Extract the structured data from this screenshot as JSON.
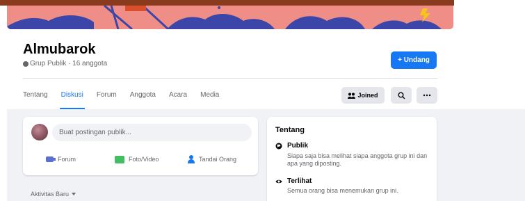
{
  "group": {
    "name": "Almubarok",
    "meta": "Grup Publik · 16 anggota"
  },
  "header": {
    "invite_label": "+ Undang",
    "joined_label": "Joined"
  },
  "tabs": [
    {
      "label": "Tentang",
      "active": false
    },
    {
      "label": "Diskusi",
      "active": true
    },
    {
      "label": "Forum",
      "active": false
    },
    {
      "label": "Anggota",
      "active": false
    },
    {
      "label": "Acara",
      "active": false
    },
    {
      "label": "Media",
      "active": false
    }
  ],
  "composer": {
    "placeholder": "Buat postingan publik...",
    "actions": {
      "forum": "Forum",
      "photo": "Foto/Video",
      "tag": "Tandai Orang"
    }
  },
  "feed": {
    "activity_label": "Aktivitas Baru"
  },
  "about": {
    "title": "Tentang",
    "public_title": "Publik",
    "public_desc": "Siapa saja bisa melihat siapa anggota grup ini dan apa yang diposting.",
    "visible_title": "Terlihat",
    "visible_desc": "Semua orang bisa menemukan grup ini."
  },
  "colors": {
    "accent": "#1877f2",
    "cover": "#ee8e86"
  },
  "icons": [
    "globe-icon",
    "search-icon",
    "more-icon",
    "group-icon",
    "forum-icon",
    "photo-icon",
    "tag-icon",
    "eye-icon",
    "caret-down-icon",
    "lightning-icon"
  ]
}
